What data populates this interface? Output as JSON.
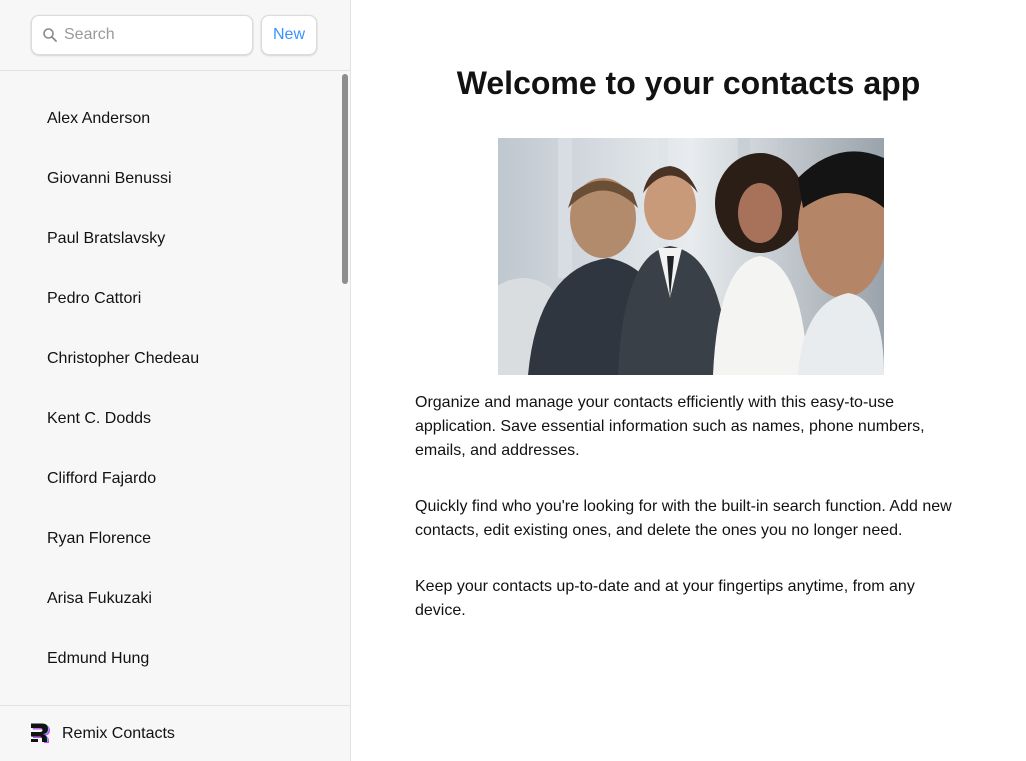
{
  "sidebar": {
    "search": {
      "placeholder": "Search",
      "value": ""
    },
    "new_label": "New",
    "contacts": [
      "Alex Anderson",
      "Giovanni Benussi",
      "Paul Bratslavsky",
      "Pedro Cattori",
      "Christopher Chedeau",
      "Kent C. Dodds",
      "Clifford Fajardo",
      "Ryan Florence",
      "Arisa Fukuzaki",
      "Edmund Hung"
    ],
    "footer": {
      "brand": "Remix Contacts"
    }
  },
  "main": {
    "title": "Welcome to your contacts app",
    "paragraphs": [
      "Organize and manage your contacts efficiently with this easy-to-use application. Save essential information such as names, phone numbers, emails, and addresses.",
      "Quickly find who you're looking for with the built-in search function. Add new contacts, edit existing ones, and delete the ones you no longer need.",
      "Keep your contacts up-to-date and at your fingertips anytime, from any device."
    ]
  },
  "colors": {
    "accent": "#3992ff",
    "text": "#121212",
    "sidebar_bg": "#f7f7f7"
  }
}
